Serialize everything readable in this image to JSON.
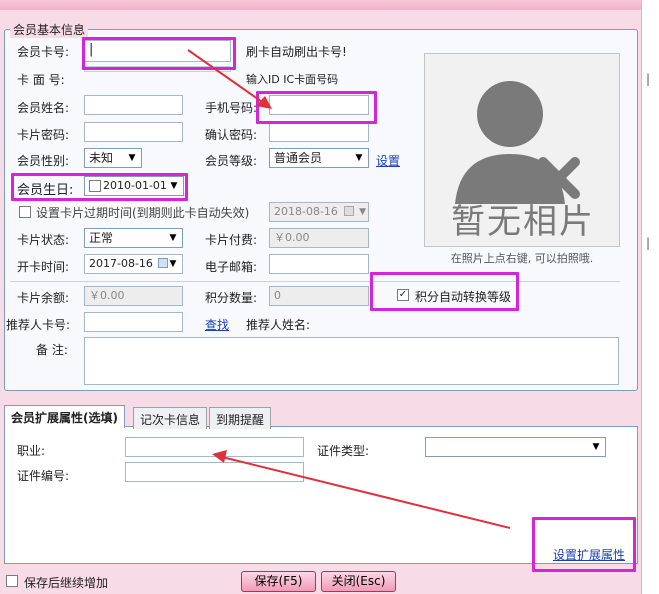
{
  "basic": {
    "legend": "会员基本信息",
    "card_no_label": "会员卡号:",
    "card_no_value": "|",
    "card_hint": "刷卡自动刷出卡号!",
    "card_face_label": "卡 面 号:",
    "card_face_hint": "输入ID IC卡面号码",
    "name_label": "会员姓名:",
    "phone_label": "手机号码:",
    "pwd_label": "卡片密码:",
    "confirm_pwd_label": "确认密码:",
    "gender_label": "会员性别:",
    "gender_value": "未知",
    "level_label": "会员等级:",
    "level_value": "普通会员",
    "level_setting_link": "设置",
    "birthday_label": "会员生日:",
    "birthday_value": "2010-01-01",
    "expire_check_label": "设置卡片过期时间(到期则此卡自动失效)",
    "expire_date": "2018-08-16",
    "status_label": "卡片状态:",
    "status_value": "正常",
    "fee_label": "卡片付费:",
    "fee_value": "￥0.00",
    "open_time_label": "开卡时间:",
    "open_time_value": "2017-08-16",
    "email_label": "电子邮箱:",
    "balance_label": "卡片余额:",
    "balance_value": "￥0.00",
    "points_label": "积分数量:",
    "points_value": "0",
    "auto_level_label": "积分自动转换等级",
    "auto_level_checked": "✓",
    "referrer_no_label": "推荐人卡号:",
    "lookup_link": "查找",
    "referrer_name_label": "推荐人姓名:",
    "remark_label": "备 注:"
  },
  "photo": {
    "placeholder_text": "暂无相片",
    "caption": "在照片上点右键, 可以拍照哦."
  },
  "tabs": [
    {
      "label": "会员扩展属性(选填)"
    },
    {
      "label": "记次卡信息"
    },
    {
      "label": "到期提醒"
    }
  ],
  "ext": {
    "job_label": "职业:",
    "id_type_label": "证件类型:",
    "id_no_label": "证件编号:",
    "set_ext_link": "设置扩展属性"
  },
  "footer": {
    "continue_label": "保存后继续增加",
    "save_label": "保存(F5)",
    "close_label": "关闭(Esc)"
  },
  "colors": {
    "highlight": "#d325d9",
    "arrow": "#e0303a",
    "link": "#1a3fb8"
  }
}
